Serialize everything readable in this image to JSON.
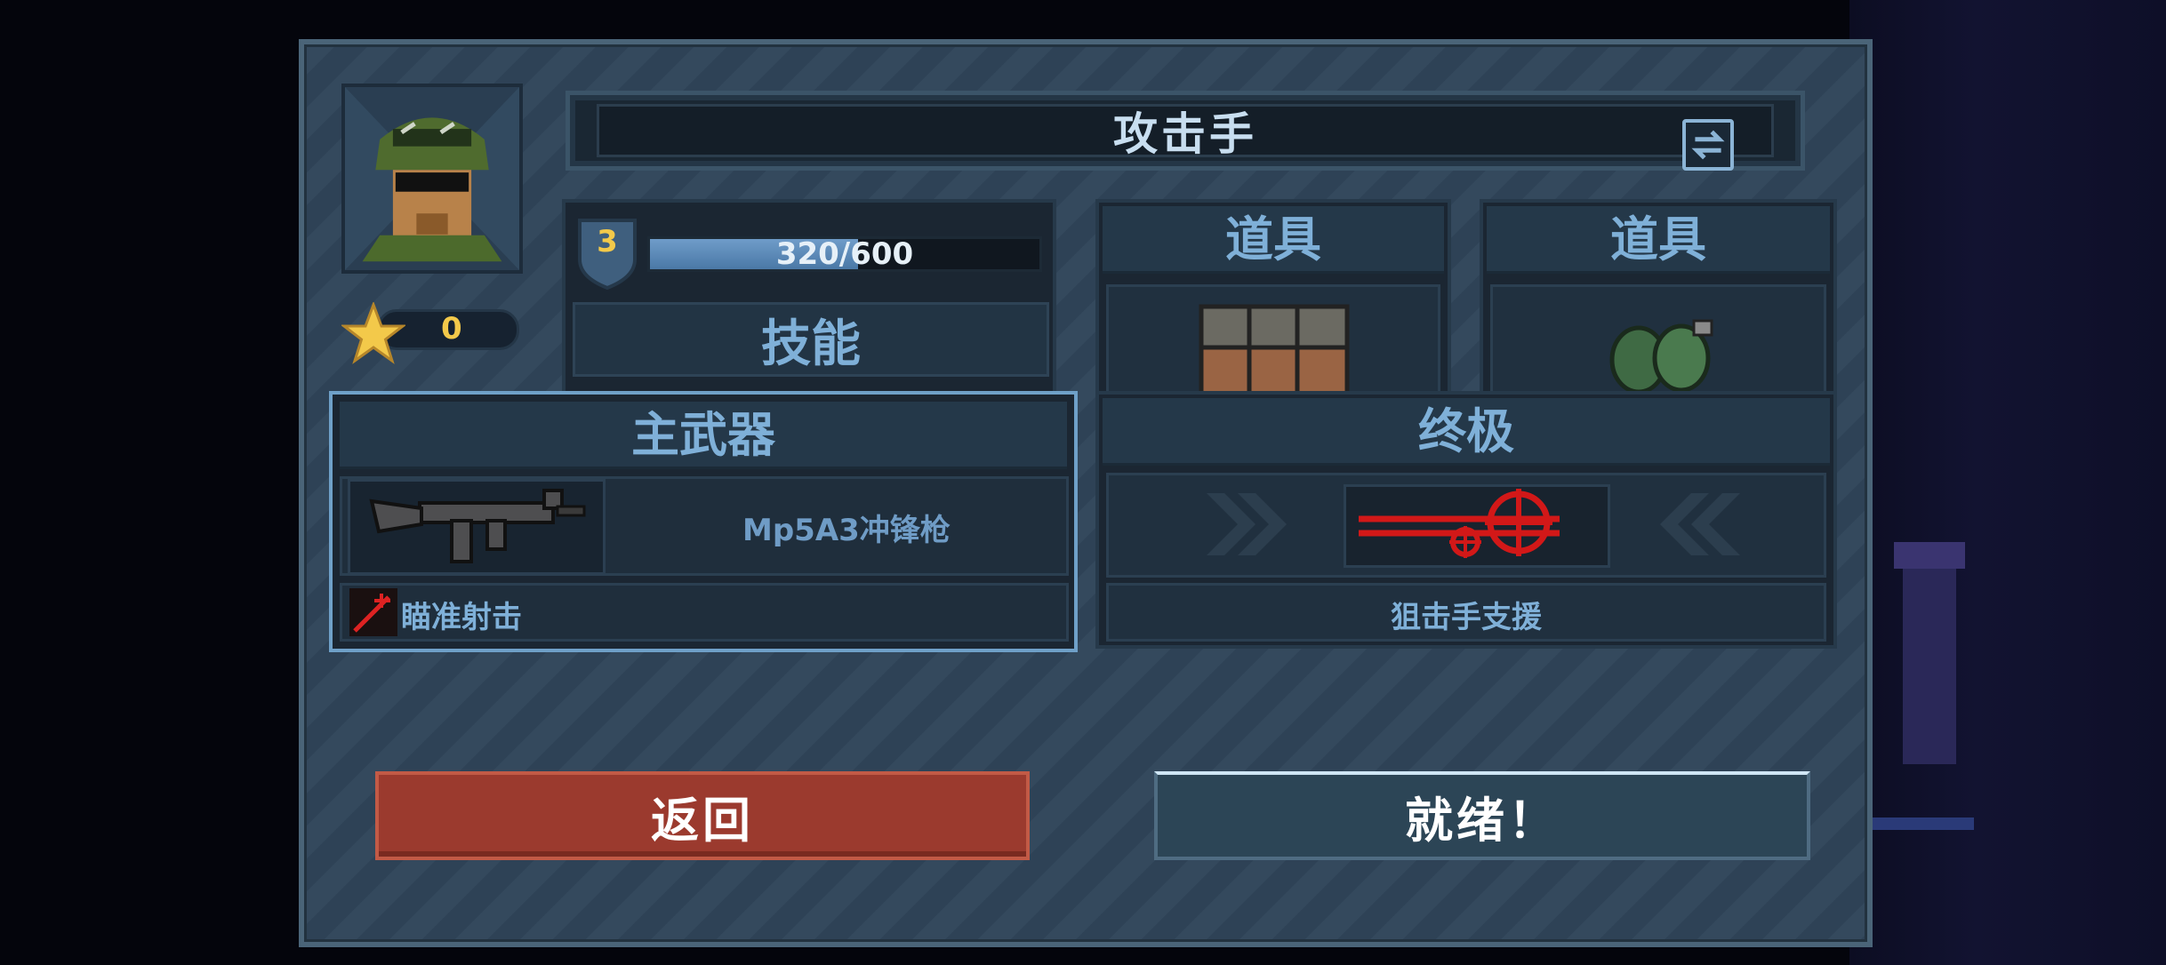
{
  "header": {
    "class_title": "攻击手",
    "swap_icon": "swap-icon"
  },
  "profile": {
    "portrait_icon": "soldier-portrait-icon",
    "star_icon": "star-icon",
    "star_count": "0"
  },
  "level": {
    "level_number": "3",
    "xp_text": "320/600",
    "xp_progress": 0.5333,
    "skill_label": "技能"
  },
  "items": [
    {
      "heading": "道具",
      "icon": "ammo-crate-icon"
    },
    {
      "heading": "道具",
      "icon": "grenades-icon"
    }
  ],
  "primary_weapon": {
    "heading": "主武器",
    "weapon_icon": "smg-icon",
    "weapon_name": "Mp5A3冲锋枪",
    "perk_icon": "crosshair-shot-icon",
    "perk_label": "瞄准射击"
  },
  "ultimate": {
    "heading": "终极",
    "icon": "sniper-support-icon",
    "label": "狙击手支援"
  },
  "buttons": {
    "back_label": "返回",
    "ready_label": "就绪！"
  },
  "colors": {
    "back_button": "#9b3a2e",
    "ready_button": "#2c4556",
    "accent_blue": "#7fb0d8",
    "star_gold": "#f3c94a"
  }
}
